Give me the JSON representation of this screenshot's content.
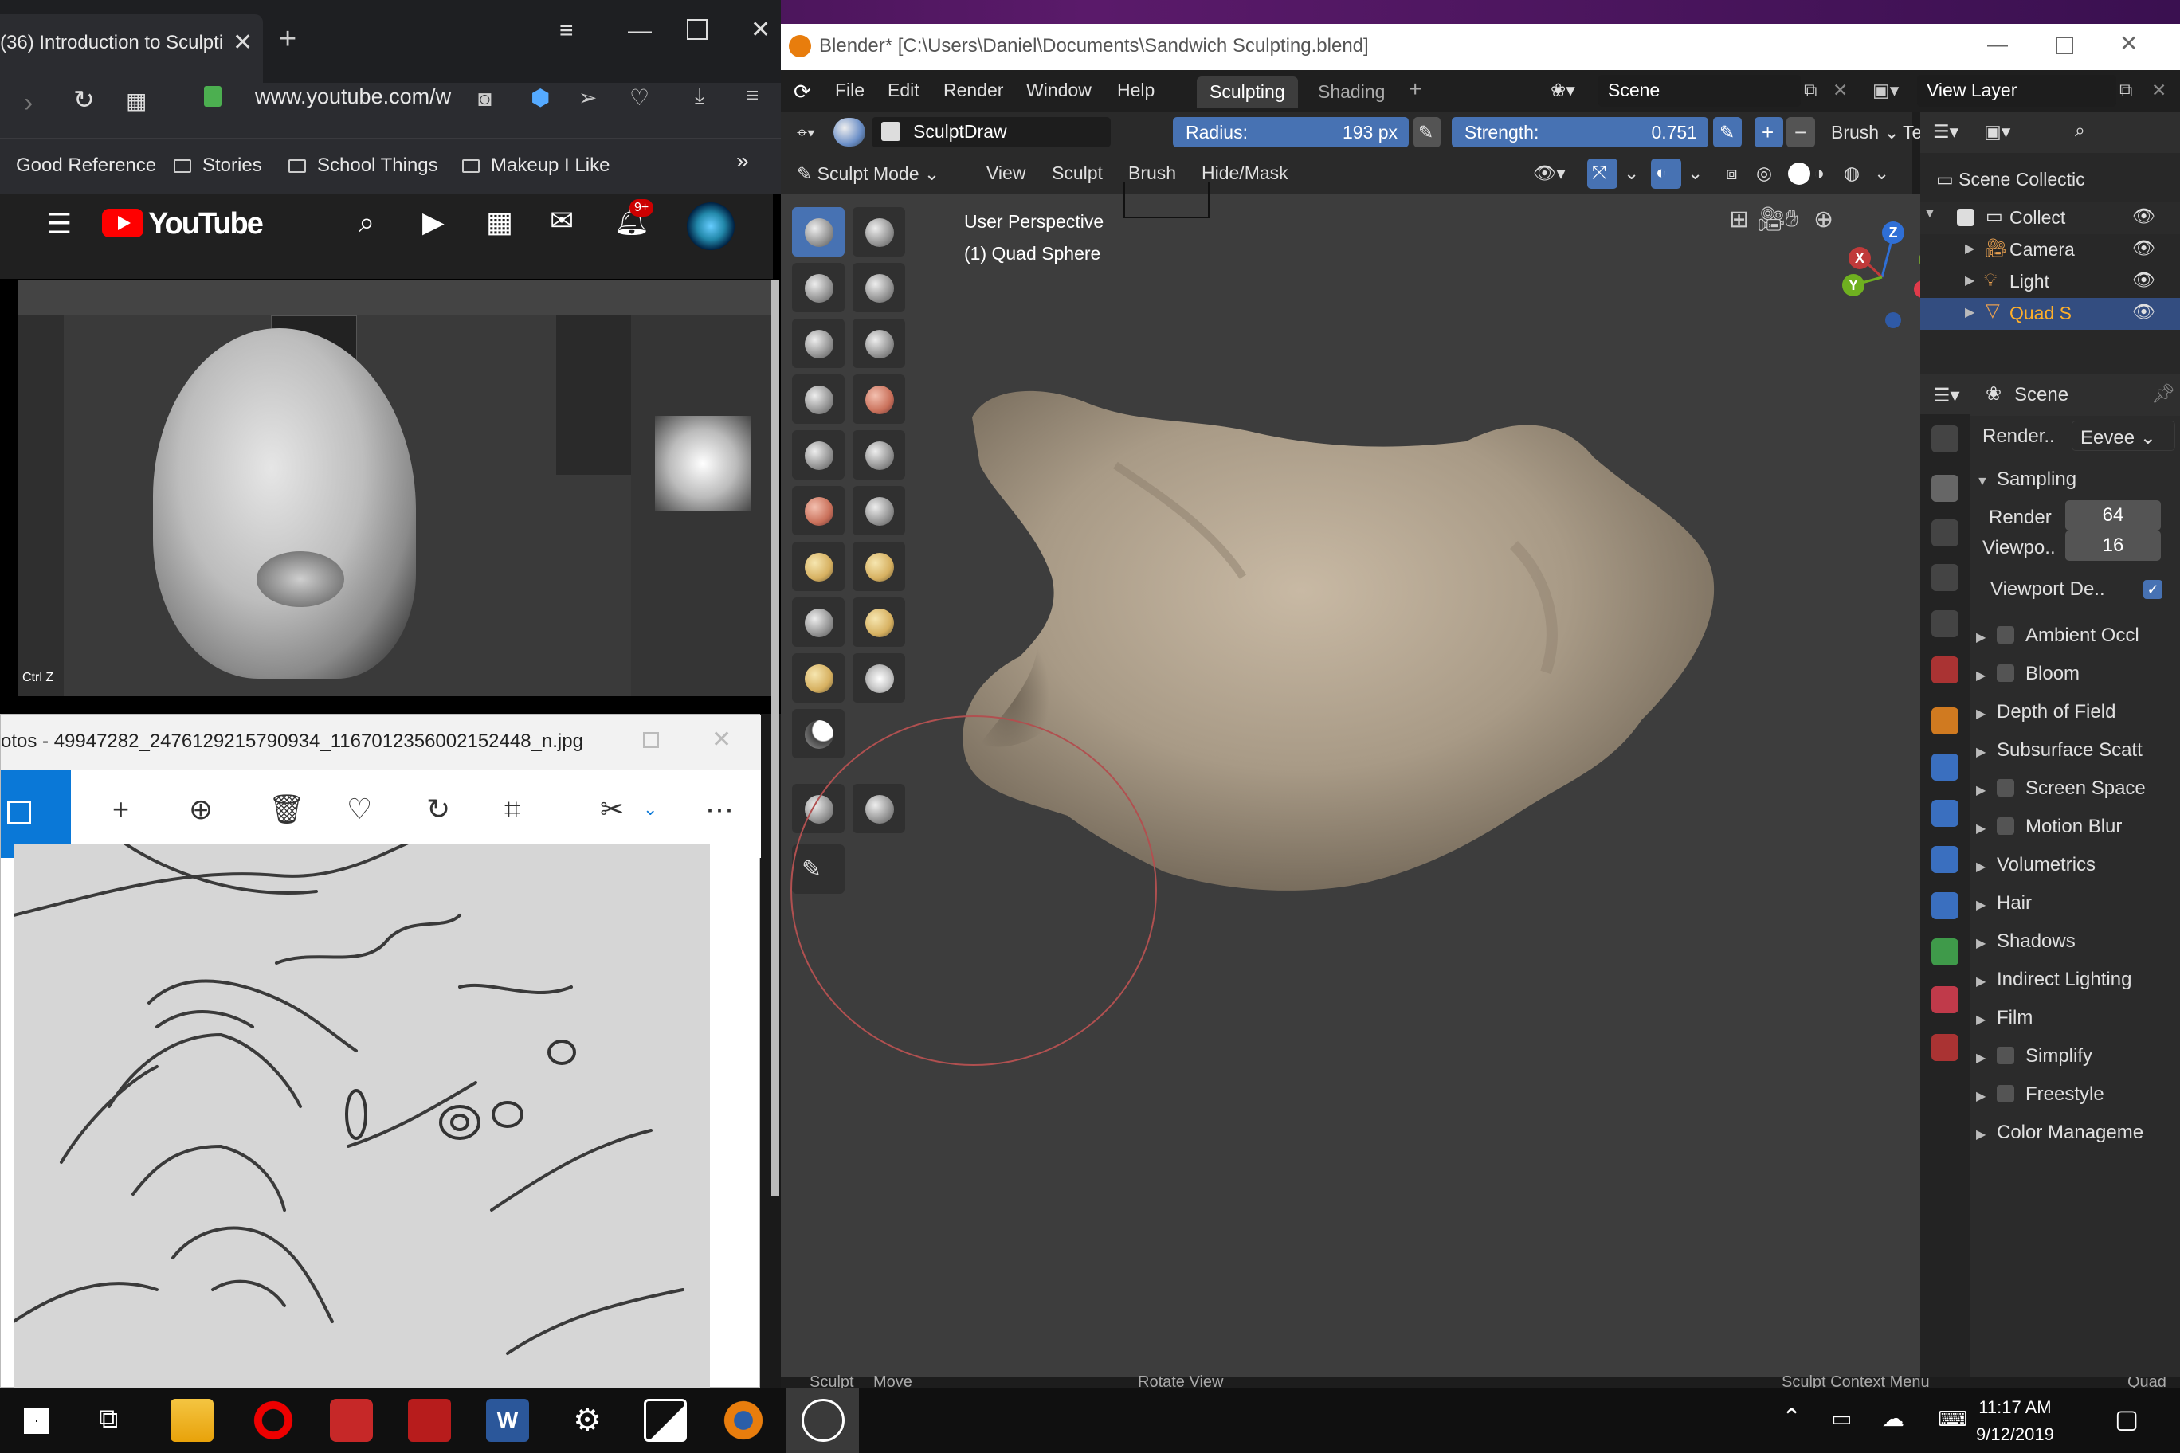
{
  "browser": {
    "tab_title": "(36) Introduction to Sculpti",
    "url": "www.youtube.com/w",
    "bookmarks": [
      "Good Reference",
      "Stories",
      "School Things",
      "Makeup I Like"
    ],
    "youtube": {
      "logo_text": "YouTube",
      "notif_count": "9+",
      "video_overlay": "Ctrl Z"
    }
  },
  "photos": {
    "title": "otos - 49947282_2476129215790934_1167012356002152448_n.jpg"
  },
  "blender": {
    "title": "Blender* [C:\\Users\\Daniel\\Documents\\Sandwich Sculpting.blend]",
    "menu": [
      "File",
      "Edit",
      "Render",
      "Window",
      "Help"
    ],
    "workspaces": [
      "Sculpting",
      "Shading"
    ],
    "scene": "Scene",
    "view_layer": "View Layer",
    "brush_name": "SculptDraw",
    "radius_label": "Radius:",
    "radius_value": "193 px",
    "strength_label": "Strength:",
    "strength_value": "0.751",
    "brush_menu": "Brush",
    "texture_menu": "Texture",
    "mode": "Sculpt Mode",
    "mode_menus": [
      "View",
      "Sculpt",
      "Brush",
      "Hide/Mask"
    ],
    "viewport_label_1": "User Perspective",
    "viewport_label_2": "(1) Quad Sphere",
    "status": {
      "left": "Sculpt",
      "move": "Move",
      "rotate": "Rotate View",
      "context": "Sculpt Context Menu",
      "right": "Quad"
    }
  },
  "outliner": {
    "items": [
      "Scene Collectic",
      "Collect",
      "Camera",
      "Light",
      "Quad S"
    ]
  },
  "properties": {
    "context": "Scene",
    "render_engine_label": "Render..",
    "render_engine": "Eevee",
    "sampling": "Sampling",
    "render_label": "Render",
    "render_samples": "64",
    "viewport_label": "Viewpo..",
    "viewport_samples": "16",
    "viewport_denoise": "Viewport De..",
    "panels": [
      "Ambient Occl",
      "Bloom",
      "Depth of Field",
      "Subsurface Scatt",
      "Screen Space",
      "Motion Blur",
      "Volumetrics",
      "Hair",
      "Shadows",
      "Indirect Lighting",
      "Film",
      "Simplify",
      "Freestyle",
      "Color Manageme"
    ]
  },
  "taskbar": {
    "time": "11:17 AM",
    "date": "9/12/2019"
  },
  "colors": {
    "accent": "#4772b3",
    "youtube_red": "#ff0000",
    "blender_orange": "#e87d0d",
    "clay": "#a89a86"
  }
}
